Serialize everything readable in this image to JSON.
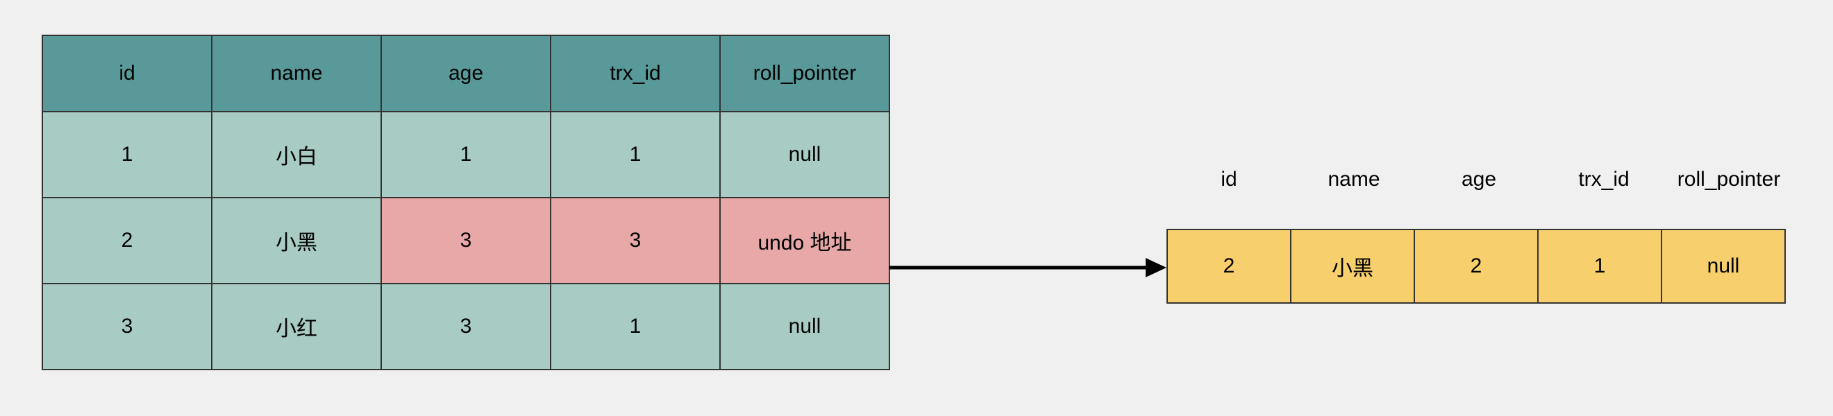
{
  "main_table": {
    "headers": [
      "id",
      "name",
      "age",
      "trx_id",
      "roll_pointer"
    ],
    "rows": [
      {
        "cells": [
          "1",
          "小白",
          "1",
          "1",
          "null"
        ],
        "highlight": []
      },
      {
        "cells": [
          "2",
          "小黑",
          "3",
          "3",
          "undo 地址"
        ],
        "highlight": [
          2,
          3,
          4
        ]
      },
      {
        "cells": [
          "3",
          "小红",
          "3",
          "1",
          "null"
        ],
        "highlight": []
      }
    ]
  },
  "undo_record": {
    "headers": [
      "id",
      "name",
      "age",
      "trx_id",
      "roll_pointer"
    ],
    "cells": [
      "2",
      "小黑",
      "2",
      "1",
      "null"
    ]
  }
}
